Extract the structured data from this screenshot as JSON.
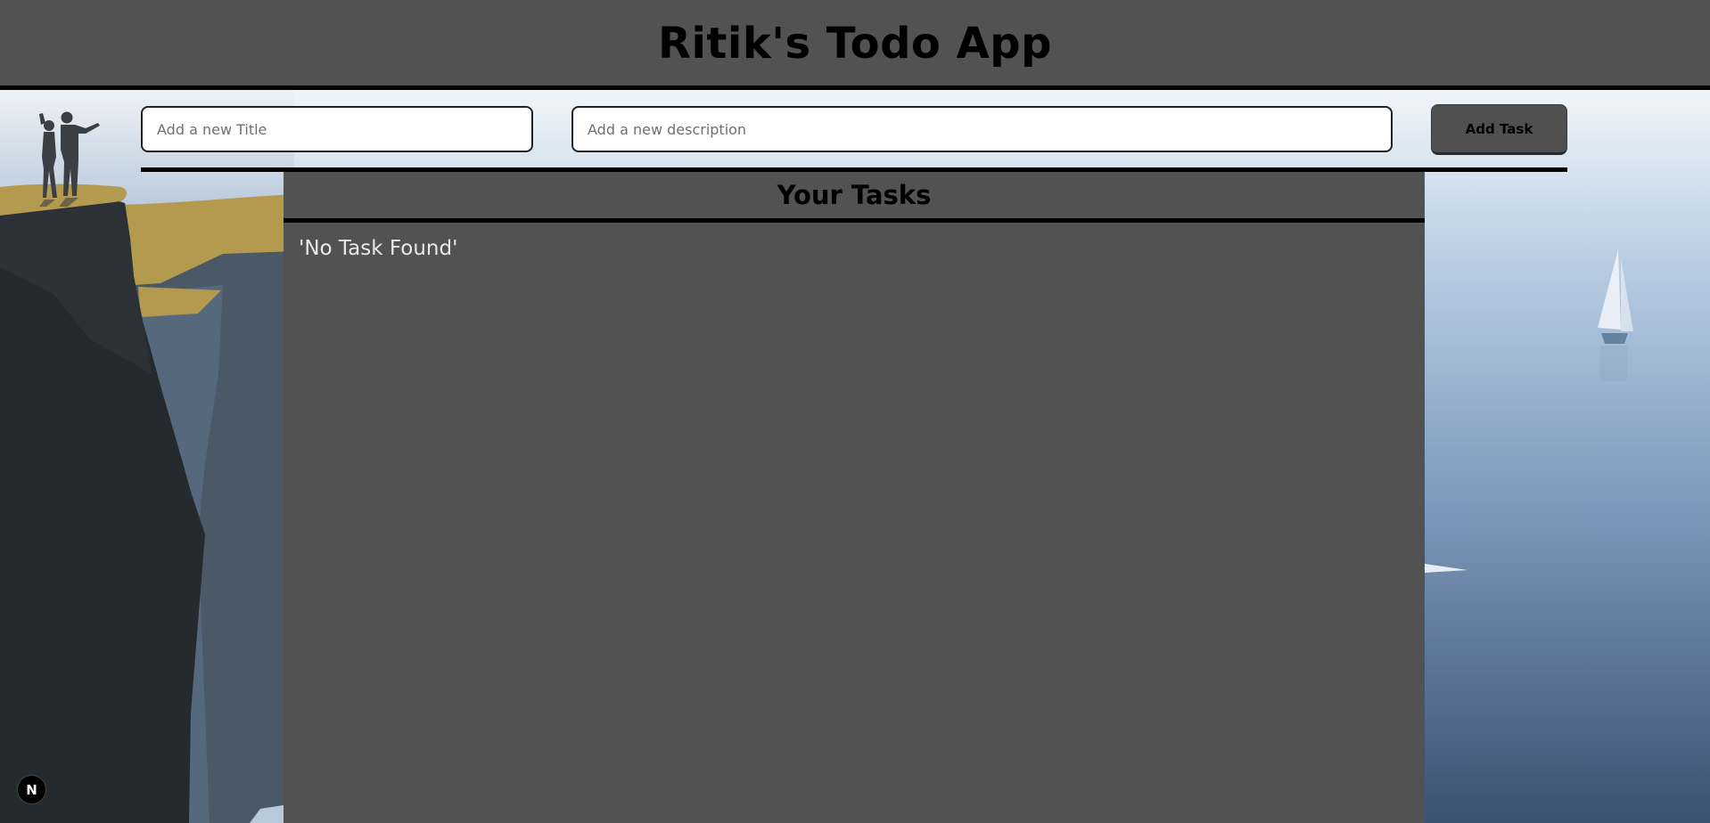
{
  "header": {
    "title": "Ritik's Todo App"
  },
  "form": {
    "title_placeholder": "Add a new Title",
    "description_placeholder": "Add a new description",
    "add_button_label": "Add Task"
  },
  "tasks": {
    "heading": "Your Tasks",
    "empty_message": "'No Task Found'",
    "items": []
  },
  "dev_badge": {
    "letter": "N",
    "icon": "nextjs-icon"
  },
  "colors": {
    "header_bg": "#525252",
    "panel_bg": "#525252",
    "button_bg": "#505050",
    "divider": "#000000",
    "cliff_dark": "#252a2f",
    "sand": "#b39a4f",
    "sea_top": "#b8cde3",
    "sea_bottom": "#3b5272"
  }
}
